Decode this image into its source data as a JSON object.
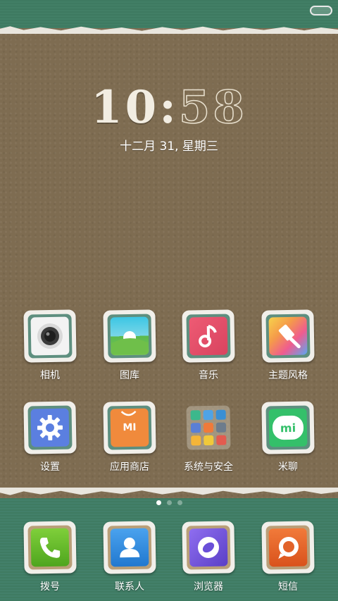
{
  "clock": {
    "hours": "10",
    "separator": ":",
    "minutes": "58"
  },
  "date": "十二月 31, 星期三",
  "apps": [
    {
      "label": "相机",
      "icon": "camera-icon"
    },
    {
      "label": "图库",
      "icon": "gallery-icon"
    },
    {
      "label": "音乐",
      "icon": "music-icon"
    },
    {
      "label": "主题风格",
      "icon": "themes-icon"
    },
    {
      "label": "设置",
      "icon": "settings-gear-icon"
    },
    {
      "label": "应用商店",
      "icon": "app-store-icon"
    },
    {
      "label": "系统与安全",
      "icon": "folder-icon"
    },
    {
      "label": "米聊",
      "icon": "mitalk-icon"
    }
  ],
  "mi_logo_text": "MI",
  "mitalk_logo_text": "mi",
  "dock": [
    {
      "label": "拨号",
      "icon": "phone-icon"
    },
    {
      "label": "联系人",
      "icon": "contacts-icon"
    },
    {
      "label": "浏览器",
      "icon": "browser-icon"
    },
    {
      "label": "短信",
      "icon": "messages-icon"
    }
  ],
  "page_indicator": {
    "pages": 3,
    "current": 1
  },
  "colors": {
    "felt_green": "#3f7a62",
    "cork_brown": "#7e6c51",
    "paper": "#e9e6de"
  }
}
